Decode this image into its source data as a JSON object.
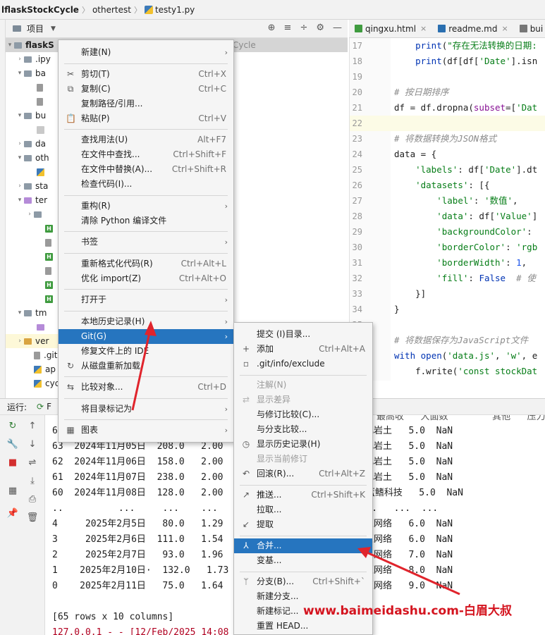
{
  "breadcrumb": [
    "lflaskStockCycle",
    "othertest",
    "testy1.py"
  ],
  "project_panel": {
    "title": "项目"
  },
  "tree": [
    {
      "label": "flaskS",
      "top": 0
    },
    {
      "label": ".ipy"
    },
    {
      "label": "ba"
    },
    {
      "label": ""
    },
    {
      "label": ""
    },
    {
      "label": "bu"
    },
    {
      "label": ""
    },
    {
      "label": "da"
    },
    {
      "label": "oth"
    },
    {
      "label": ""
    },
    {
      "label": "sta"
    },
    {
      "label": "ter"
    },
    {
      "label": ""
    },
    {
      "label": ""
    },
    {
      "label": ""
    },
    {
      "label": ""
    },
    {
      "label": ""
    },
    {
      "label": ""
    },
    {
      "label": ""
    },
    {
      "label": "tm"
    },
    {
      "label": ""
    },
    {
      "label": "ver"
    },
    {
      "label": ".git"
    },
    {
      "label": "ap"
    },
    {
      "label": "cyc"
    }
  ],
  "tree_hint": "StockCycle",
  "editor": {
    "tabs": [
      {
        "label": "qingxu.html"
      },
      {
        "label": "readme.md"
      },
      {
        "label": "bui"
      }
    ],
    "lines": [
      {
        "n": "17",
        "parts": [
          [
            "    ",
            ""
          ],
          [
            "print",
            "k"
          ],
          [
            "(",
            ""
          ],
          [
            "\"存在无法转换的日期:",
            "s"
          ]
        ]
      },
      {
        "n": "18",
        "parts": [
          [
            "    ",
            ""
          ],
          [
            "print",
            "k"
          ],
          [
            "(df[df[",
            ""
          ],
          [
            "'Date'",
            "s"
          ],
          [
            "].isn",
            ""
          ]
        ]
      },
      {
        "n": "19",
        "parts": []
      },
      {
        "n": "20",
        "parts": [
          [
            "# 按日期排序",
            "c"
          ]
        ]
      },
      {
        "n": "21",
        "parts": [
          [
            "df = df.dropna(",
            ""
          ],
          [
            "subset",
            "id"
          ],
          [
            "=[",
            ""
          ],
          [
            "'Dat",
            "s"
          ]
        ]
      },
      {
        "n": "22",
        "parts": []
      },
      {
        "n": "23",
        "parts": [
          [
            "# 将数据转换为JSON格式",
            "c"
          ]
        ]
      },
      {
        "n": "24",
        "parts": [
          [
            "data = {",
            ""
          ]
        ]
      },
      {
        "n": "25",
        "parts": [
          [
            "    ",
            ""
          ],
          [
            "'labels'",
            "s"
          ],
          [
            ": df[",
            ""
          ],
          [
            "'Date'",
            "s"
          ],
          [
            "].dt",
            ""
          ]
        ]
      },
      {
        "n": "26",
        "parts": [
          [
            "    ",
            ""
          ],
          [
            "'datasets'",
            "s"
          ],
          [
            ": [{",
            ""
          ]
        ]
      },
      {
        "n": "27",
        "parts": [
          [
            "        ",
            ""
          ],
          [
            "'label'",
            "s"
          ],
          [
            ": ",
            ""
          ],
          [
            "'数值'",
            "s"
          ],
          [
            ",",
            ""
          ]
        ]
      },
      {
        "n": "28",
        "parts": [
          [
            "        ",
            ""
          ],
          [
            "'data'",
            "s"
          ],
          [
            ": df[",
            ""
          ],
          [
            "'Value'",
            "s"
          ],
          [
            "]",
            ""
          ]
        ]
      },
      {
        "n": "29",
        "parts": [
          [
            "        ",
            ""
          ],
          [
            "'backgroundColor'",
            "s"
          ],
          [
            ":",
            ""
          ]
        ]
      },
      {
        "n": "30",
        "parts": [
          [
            "        ",
            ""
          ],
          [
            "'borderColor'",
            "s"
          ],
          [
            ": ",
            ""
          ],
          [
            "'rgb",
            "s"
          ]
        ]
      },
      {
        "n": "31",
        "parts": [
          [
            "        ",
            ""
          ],
          [
            "'borderWidth'",
            "s"
          ],
          [
            ": ",
            ""
          ],
          [
            "1",
            "n"
          ],
          [
            ",",
            ""
          ]
        ]
      },
      {
        "n": "32",
        "parts": [
          [
            "        ",
            ""
          ],
          [
            "'fill'",
            "s"
          ],
          [
            ": ",
            ""
          ],
          [
            "False",
            "k"
          ],
          [
            "  ",
            ""
          ],
          [
            "# 使",
            "c"
          ]
        ]
      },
      {
        "n": "33",
        "parts": [
          [
            "    }]",
            ""
          ]
        ]
      },
      {
        "n": "34",
        "parts": [
          [
            "}",
            ""
          ]
        ]
      },
      {
        "n": "35",
        "parts": []
      },
      {
        "n": "36",
        "parts": [
          [
            "# 将数据保存为JavaScript文件",
            "c"
          ]
        ]
      },
      {
        "n": "37",
        "parts": [
          [
            "with",
            "k"
          ],
          [
            " ",
            ""
          ],
          [
            "open",
            "k"
          ],
          [
            "(",
            ""
          ],
          [
            "'data.js'",
            "s"
          ],
          [
            ", ",
            ""
          ],
          [
            "'w'",
            "s"
          ],
          [
            ", e",
            ""
          ]
        ]
      },
      {
        "n": "38",
        "parts": [
          [
            "    f.write(",
            ""
          ],
          [
            "'const stockDat",
            "s"
          ]
        ]
      }
    ]
  },
  "run": {
    "label": "运行:",
    "tab": "F"
  },
  "console": {
    "header_right": "最高收   大面数        其他   压力高",
    "lines": [
      "6",
      "63  2024年11月05日  208.0   2.00",
      "62  2024年11月06日  158.0   2.00",
      "61  2024年11月07日  238.0   2.00",
      "60  2024年11月08日  128.0   2.00",
      "..          ...     ...    ...",
      "4     2025年2月5日   80.0   1.29",
      "3     2025年2月6日  111.0   1.54",
      "2     2025年2月7日   93.0   1.96",
      "1    2025年2月10日·  132.0   1.73",
      "0    2025年2月11日   75.0   1.64",
      "",
      "[65 rows x 10 columns]",
      "127.0.0.1 - - [12/Feb/2025 14:08"
    ],
    "right_lines": [
      "中化岩土   5.0  NaN",
      "中化岩土   5.0  NaN",
      "中化岩土   5.0  NaN",
      "中化岩土   5.0  NaN",
      "英洛华-蓝鳍科技   5.0  NaN",
      "  ...   ...  ...",
      "新炬网络   6.0  NaN",
      "新炬网络   6.0  NaN",
      "新炬网络   7.0  NaN",
      "新炬网络   8.0  NaN",
      "新炬网络   9.0  NaN",
      "1\" 200 -"
    ]
  },
  "context_menu": [
    {
      "label": "新建(N)",
      "sub": "›"
    },
    {
      "sep": true
    },
    {
      "label": "剪切(T)",
      "shortcut": "Ctrl+X",
      "icon": "✂"
    },
    {
      "label": "复制(C)",
      "shortcut": "Ctrl+C",
      "icon": "⧉"
    },
    {
      "label": "复制路径/引用...",
      "shortcut": ""
    },
    {
      "label": "粘贴(P)",
      "shortcut": "Ctrl+V",
      "icon": "📋"
    },
    {
      "sep": true
    },
    {
      "label": "查找用法(U)",
      "shortcut": "Alt+F7"
    },
    {
      "label": "在文件中查找...",
      "shortcut": "Ctrl+Shift+F"
    },
    {
      "label": "在文件中替换(A)...",
      "shortcut": "Ctrl+Shift+R"
    },
    {
      "label": "检查代码(I)..."
    },
    {
      "sep": true
    },
    {
      "label": "重构(R)",
      "sub": "›"
    },
    {
      "label": "清除 Python 编译文件"
    },
    {
      "sep": true
    },
    {
      "label": "书签",
      "sub": "›"
    },
    {
      "sep": true
    },
    {
      "label": "重新格式化代码(R)",
      "shortcut": "Ctrl+Alt+L"
    },
    {
      "label": "优化 import(Z)",
      "shortcut": "Ctrl+Alt+O"
    },
    {
      "sep": true
    },
    {
      "label": "打开于",
      "sub": "›"
    },
    {
      "sep": true
    },
    {
      "label": "本地历史记录(H)",
      "sub": "›"
    },
    {
      "label": "Git(G)",
      "sub": "›",
      "highlight": true
    },
    {
      "label": "修复文件上的 IDE"
    },
    {
      "label": "从磁盘重新加载",
      "icon": "↻"
    },
    {
      "sep": true
    },
    {
      "label": "比较对象...",
      "shortcut": "Ctrl+D",
      "icon": "⇆"
    },
    {
      "sep": true
    },
    {
      "label": "将目录标记为",
      "sub": "›"
    },
    {
      "sep": true
    },
    {
      "label": "图表",
      "sub": "›",
      "icon": "▦"
    }
  ],
  "git_menu": [
    {
      "label": "提交 (I)目录..."
    },
    {
      "label": "添加",
      "shortcut": "Ctrl+Alt+A",
      "icon": "+"
    },
    {
      "label": ".git/info/exclude",
      "icon": "▫"
    },
    {
      "sep": true
    },
    {
      "label": "注解(N)",
      "disabled": true
    },
    {
      "label": "显示差异",
      "disabled": true,
      "icon": "⇄"
    },
    {
      "label": "与修订比较(C)..."
    },
    {
      "label": "与分支比较..."
    },
    {
      "label": "显示历史记录(H)",
      "icon": "◷"
    },
    {
      "label": "显示当前修订",
      "disabled": true
    },
    {
      "label": "回滚(R)...",
      "shortcut": "Ctrl+Alt+Z",
      "icon": "↶"
    },
    {
      "sep": true
    },
    {
      "label": "推送...",
      "shortcut": "Ctrl+Shift+K",
      "icon": "↗"
    },
    {
      "label": "拉取..."
    },
    {
      "label": "提取",
      "icon": "↙"
    },
    {
      "sep": true
    },
    {
      "label": "合并...",
      "highlight": true,
      "icon": "⅄"
    },
    {
      "label": "变基..."
    },
    {
      "sep": true
    },
    {
      "label": "分支(B)...",
      "shortcut": "Ctrl+Shift+`",
      "icon": "ᛘ"
    },
    {
      "label": "新建分支..."
    },
    {
      "label": "新建标记..."
    },
    {
      "label": "重置 HEAD..."
    }
  ],
  "watermark": "www.baimeidashu.com-白眉大叔",
  "colors": {
    "highlight": "#2675bf",
    "annotation": "#d4141f"
  }
}
